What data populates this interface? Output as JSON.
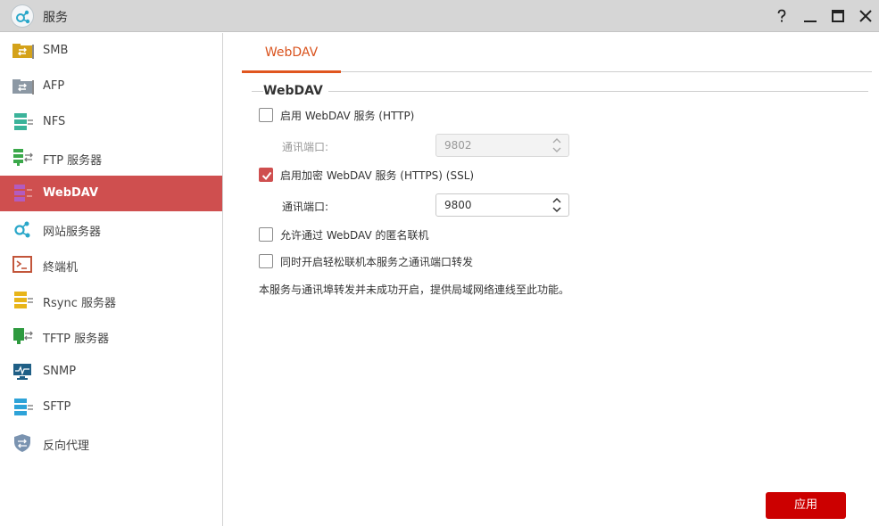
{
  "window": {
    "title": "服务",
    "controls": [
      "help-icon",
      "minimize-icon",
      "maximize-icon",
      "close-icon"
    ]
  },
  "sidebar": {
    "items": [
      {
        "label": "SMB",
        "icon": "smb-folder-icon",
        "active": false
      },
      {
        "label": "AFP",
        "icon": "afp-folder-icon",
        "active": false
      },
      {
        "label": "NFS",
        "icon": "nfs-server-icon",
        "active": false
      },
      {
        "label": "FTP 服务器",
        "icon": "ftp-server-icon",
        "active": false
      },
      {
        "label": "WebDAV",
        "icon": "webdav-icon",
        "active": true
      },
      {
        "label": "网站服务器",
        "icon": "web-server-icon",
        "active": false
      },
      {
        "label": "終端机",
        "icon": "terminal-icon",
        "active": false
      },
      {
        "label": "Rsync 服务器",
        "icon": "rsync-server-icon",
        "active": false
      },
      {
        "label": "TFTP 服务器",
        "icon": "tftp-server-icon",
        "active": false
      },
      {
        "label": "SNMP",
        "icon": "snmp-monitor-icon",
        "active": false
      },
      {
        "label": "SFTP",
        "icon": "sftp-server-icon",
        "active": false
      },
      {
        "label": "反向代理",
        "icon": "reverse-proxy-shield-icon",
        "active": false
      }
    ]
  },
  "tabs": [
    {
      "label": "WebDAV",
      "active": true
    }
  ],
  "section": {
    "title": "WebDAV"
  },
  "options": {
    "http": {
      "label": "启用 WebDAV 服务 (HTTP)",
      "checked": false
    },
    "http_port": {
      "label": "通讯端口:",
      "value": "9802",
      "disabled": true
    },
    "https": {
      "label": "启用加密 WebDAV 服务 (HTTPS) (SSL)",
      "checked": true
    },
    "https_port": {
      "label": "通讯端口:",
      "value": "9800",
      "disabled": false
    },
    "anonymous": {
      "label": "允许通过 WebDAV 的匿名联机",
      "checked": false
    },
    "port_forward": {
      "label": "同时开启轻松联机本服务之通讯端口转发",
      "checked": false
    }
  },
  "note": "本服务与通讯埠转发并未成功开启，提供局域网络連线至此功能。",
  "buttons": {
    "apply": "应用"
  },
  "colors": {
    "accent_red": "#cf4f4f",
    "tab_orange": "#e0561f",
    "apply_red": "#cc0000",
    "titlebar": "#d6d6d6"
  }
}
